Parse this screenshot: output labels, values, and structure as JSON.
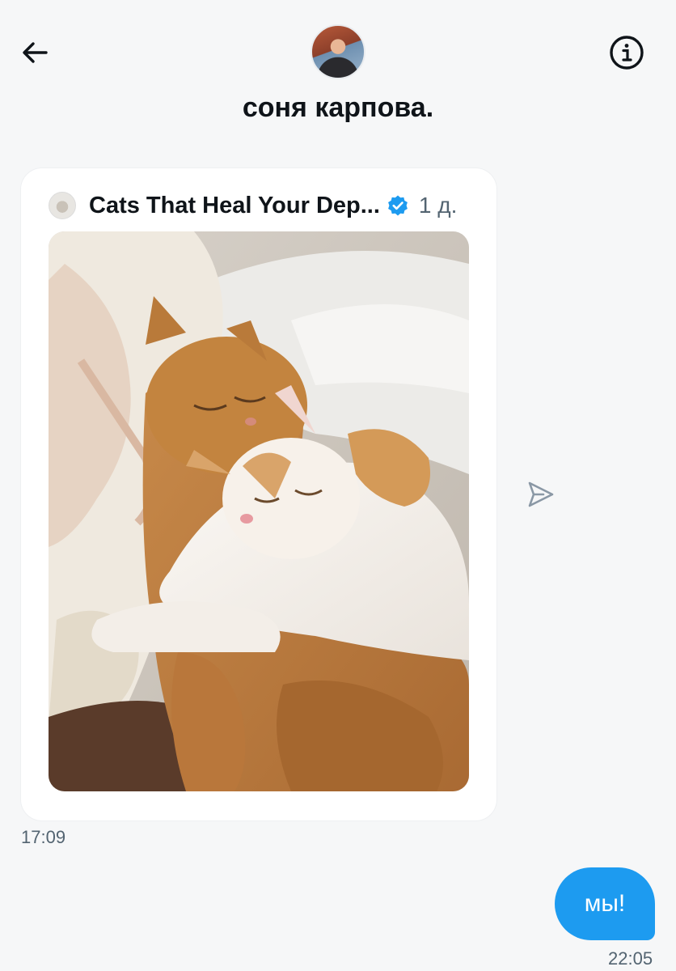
{
  "header": {
    "title": "соня карпова.",
    "back_icon": "arrow-left-icon",
    "info_icon": "info-circle-icon"
  },
  "shared_post": {
    "source_name": "Cats That Heal Your Dep...",
    "verified": true,
    "time_ago": "1 д.",
    "image_desc_icon": "photo-two-cats-sleeping"
  },
  "messages": {
    "received_time": "17:09",
    "sent_text": "мы!",
    "sent_time": "22:05"
  },
  "colors": {
    "accent": "#1d9bf0",
    "background": "#f6f7f8",
    "muted_text": "#536471"
  }
}
